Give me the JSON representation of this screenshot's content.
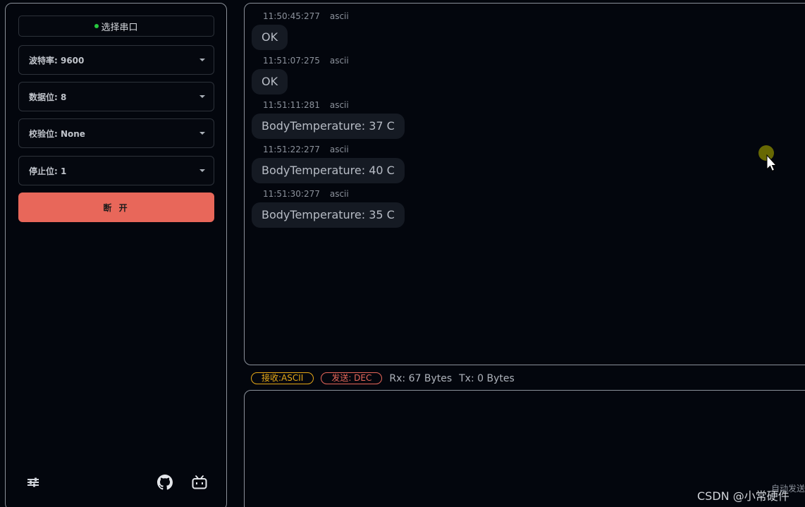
{
  "sidebar": {
    "port_button": "选择串口",
    "baud": "波特率: 9600",
    "data_bits": "数据位: 8",
    "parity": "校验位: None",
    "stop_bits": "停止位: 1",
    "disconnect": "断 开",
    "icons": [
      "settings-icon",
      "github-icon",
      "bilibili-icon"
    ]
  },
  "messages": [
    {
      "time": "11:50:45:277",
      "fmt": "ascii",
      "text": "OK"
    },
    {
      "time": "11:51:07:275",
      "fmt": "ascii",
      "text": "OK"
    },
    {
      "time": "11:51:11:281",
      "fmt": "ascii",
      "text": "BodyTemperature: 37 C"
    },
    {
      "time": "11:51:22:277",
      "fmt": "ascii",
      "text": "BodyTemperature: 40 C"
    },
    {
      "time": "11:51:30:277",
      "fmt": "ascii",
      "text": "BodyTemperature: 35 C"
    }
  ],
  "status_bar": {
    "rx_mode": "接收:ASCII",
    "tx_mode": "发送: DEC",
    "rx_count": "Rx: 67 Bytes",
    "tx_count": "Tx: 0 Bytes"
  },
  "send_area": {
    "auto_send": "自动发送"
  },
  "watermark": "CSDN @小常硬件",
  "colors": {
    "background": "#03060d",
    "border": "#8a9099",
    "disconnect": "#e8675a",
    "rx_tag": "#e6a817",
    "tx_tag": "#e8675a",
    "status_dot": "#27c93f"
  }
}
